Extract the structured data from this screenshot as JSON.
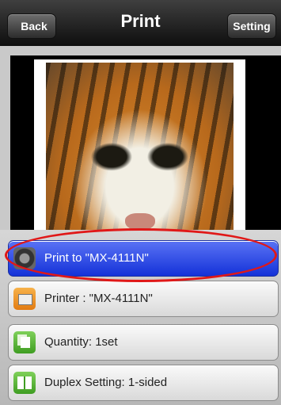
{
  "navbar": {
    "back_label": "Back",
    "title": "Print",
    "setting_label": "Setting"
  },
  "preview": {
    "expand_icon": "chevron-down-icon"
  },
  "menu": {
    "items": [
      {
        "label": "Print to \"MX-4111N\"",
        "icon": "printer-device-icon"
      },
      {
        "label": "Printer : \"MX-4111N\"",
        "icon": "printer-icon"
      },
      {
        "label": "Quantity: 1set",
        "icon": "copies-icon"
      },
      {
        "label": "Duplex Setting: 1-sided",
        "icon": "duplex-icon"
      }
    ]
  },
  "colors": {
    "selected_row": "#1f3fe6",
    "highlight_oval": "#e01818"
  }
}
